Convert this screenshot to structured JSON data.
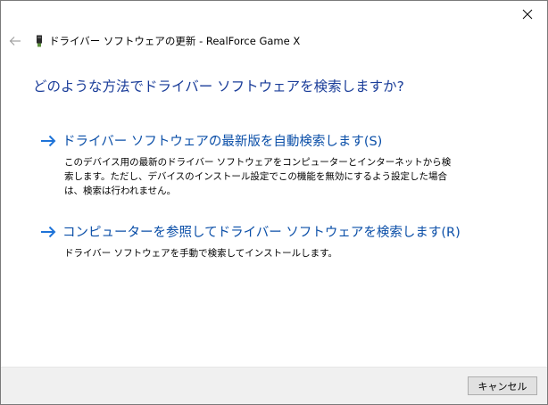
{
  "window": {
    "title": "ドライバー ソフトウェアの更新 - RealForce Game X"
  },
  "main": {
    "question": "どのような方法でドライバー ソフトウェアを検索しますか?",
    "options": [
      {
        "title": "ドライバー ソフトウェアの最新版を自動検索します(S)",
        "description": "このデバイス用の最新のドライバー ソフトウェアをコンピューターとインターネットから検索します。ただし、デバイスのインストール設定でこの機能を無効にするよう設定した場合は、検索は行われません。"
      },
      {
        "title": "コンピューターを参照してドライバー ソフトウェアを検索します(R)",
        "description": "ドライバー ソフトウェアを手動で検索してインストールします。"
      }
    ]
  },
  "footer": {
    "cancel_label": "キャンセル"
  },
  "colors": {
    "heading": "#1a3d99",
    "link": "#0b4fa8",
    "arrow": "#1e73d8",
    "footer_bg": "#f0f0f0"
  },
  "icons": {
    "back": "back-arrow-icon",
    "device": "usb-device-icon",
    "close": "close-icon",
    "option_arrow": "right-arrow-icon"
  }
}
